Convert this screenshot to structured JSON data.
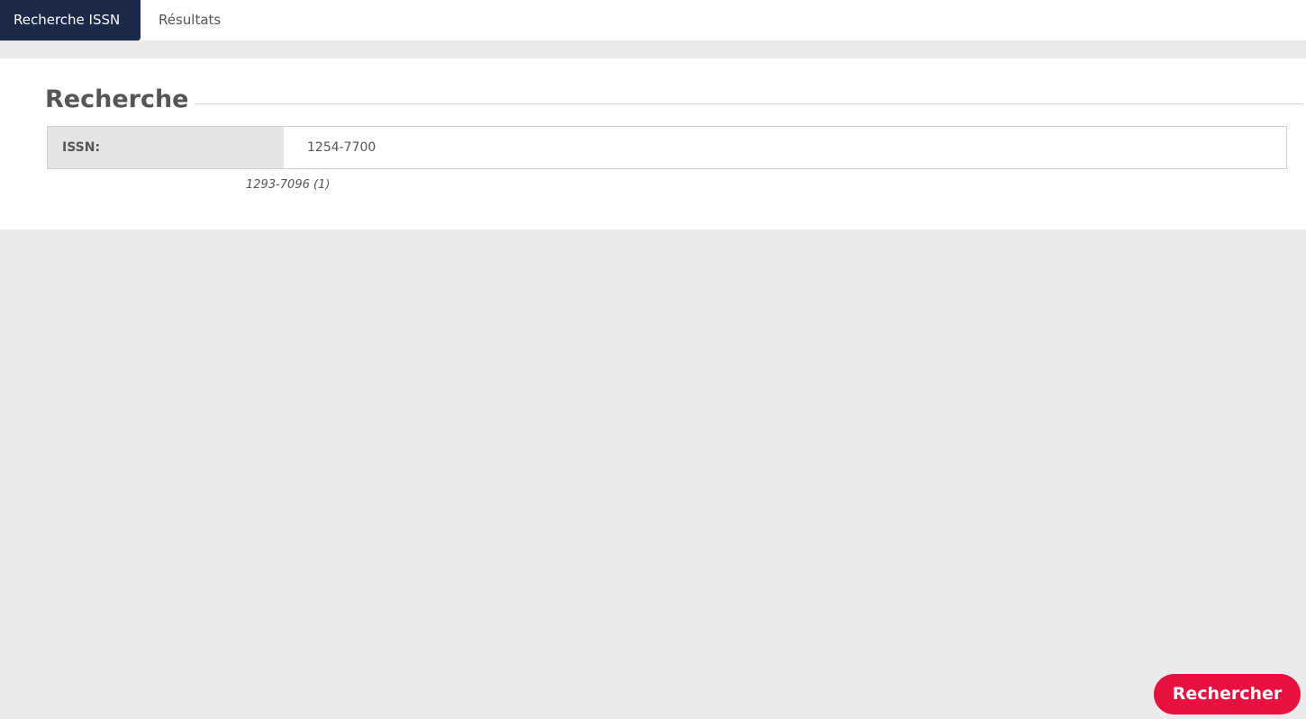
{
  "tabs": {
    "active": "Recherche ISSN",
    "results": "Résultats"
  },
  "section": {
    "title": "Recherche"
  },
  "issn_field": {
    "label": "ISSN:",
    "value": "1254-7700"
  },
  "suggestion": {
    "text": "1293-7096 (1)"
  },
  "actions": {
    "search_label": "Rechercher"
  },
  "colors": {
    "tab_active_bg": "#1b2a4a",
    "search_button_bg": "#e8103f",
    "page_bg": "#ebebeb"
  }
}
